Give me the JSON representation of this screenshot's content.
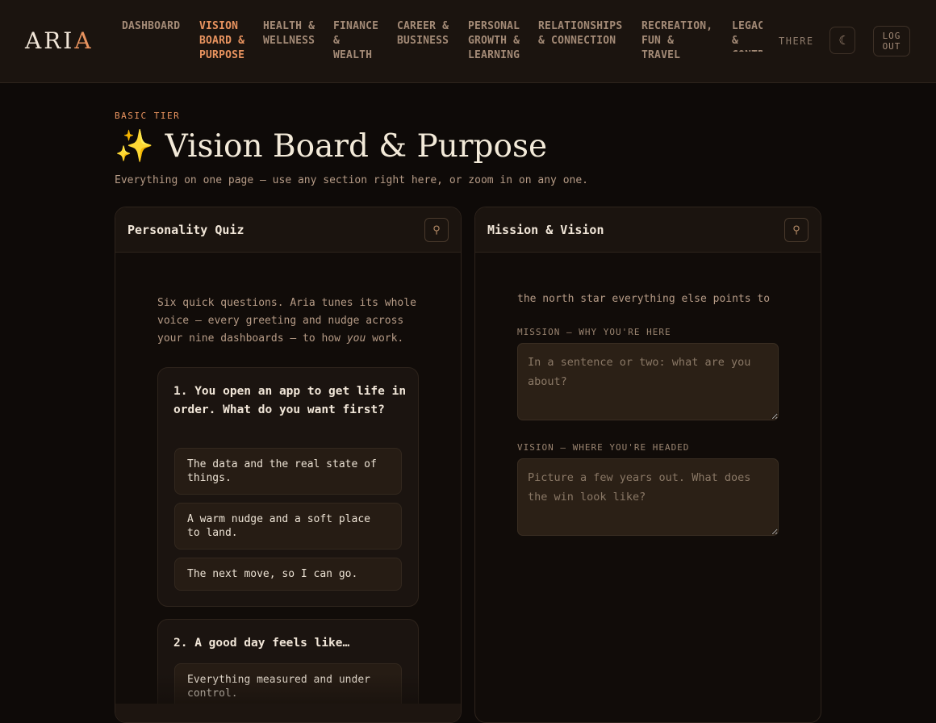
{
  "app": {
    "logo_main": "ARI",
    "logo_accent": "A",
    "user_label": "THERE",
    "theme_icon": "moon-icon",
    "logout_label": "LOG\nOUT"
  },
  "nav": [
    {
      "label": "DASHBOARD",
      "active": false
    },
    {
      "label": "VISION\nBOARD &\nPURPOSE",
      "active": true
    },
    {
      "label": "HEALTH &\nWELLNESS",
      "active": false
    },
    {
      "label": "FINANCE\n&\nWEALTH",
      "active": false
    },
    {
      "label": "CAREER &\nBUSINESS",
      "active": false
    },
    {
      "label": "PERSONAL\nGROWTH &\nLEARNING",
      "active": false
    },
    {
      "label": "RELATIONSHIPS\n& CONNECTION",
      "active": false
    },
    {
      "label": "RECREATION,\nFUN &\nTRAVEL",
      "active": false
    },
    {
      "label": "LEGACY &\nCONTRIBUTION",
      "active": false
    }
  ],
  "page": {
    "tier": "BASIC TIER",
    "title_icon": "✨",
    "title": "Vision Board & Purpose",
    "subtitle": "Everything on one page — use any section right here, or zoom in on any one."
  },
  "quiz": {
    "title": "Personality Quiz",
    "pin_icon": "pin-icon",
    "intro_before": "Six quick questions. Aria tunes its whole voice — every greeting and nudge across your nine dashboards — to how ",
    "intro_em": "you",
    "intro_after": " work.",
    "questions": [
      {
        "title": "1. You open an app to get life in order. What do you want first?",
        "options": [
          "The data and the real state of things.",
          "A warm nudge and a soft place to land.",
          "The next move, so I can go."
        ]
      },
      {
        "title": "2. A good day feels like…",
        "options": [
          "Everything measured and under control."
        ]
      }
    ]
  },
  "mission": {
    "title": "Mission & Vision",
    "pin_icon": "pin-icon",
    "tagline": "the north star everything else points to",
    "mission_label": "MISSION — WHY YOU'RE HERE",
    "mission_placeholder": "In a sentence or two: what are you about?",
    "mission_value": "",
    "vision_label": "VISION — WHERE YOU'RE HEADED",
    "vision_placeholder": "Picture a few years out. What does the win look like?",
    "vision_value": ""
  }
}
